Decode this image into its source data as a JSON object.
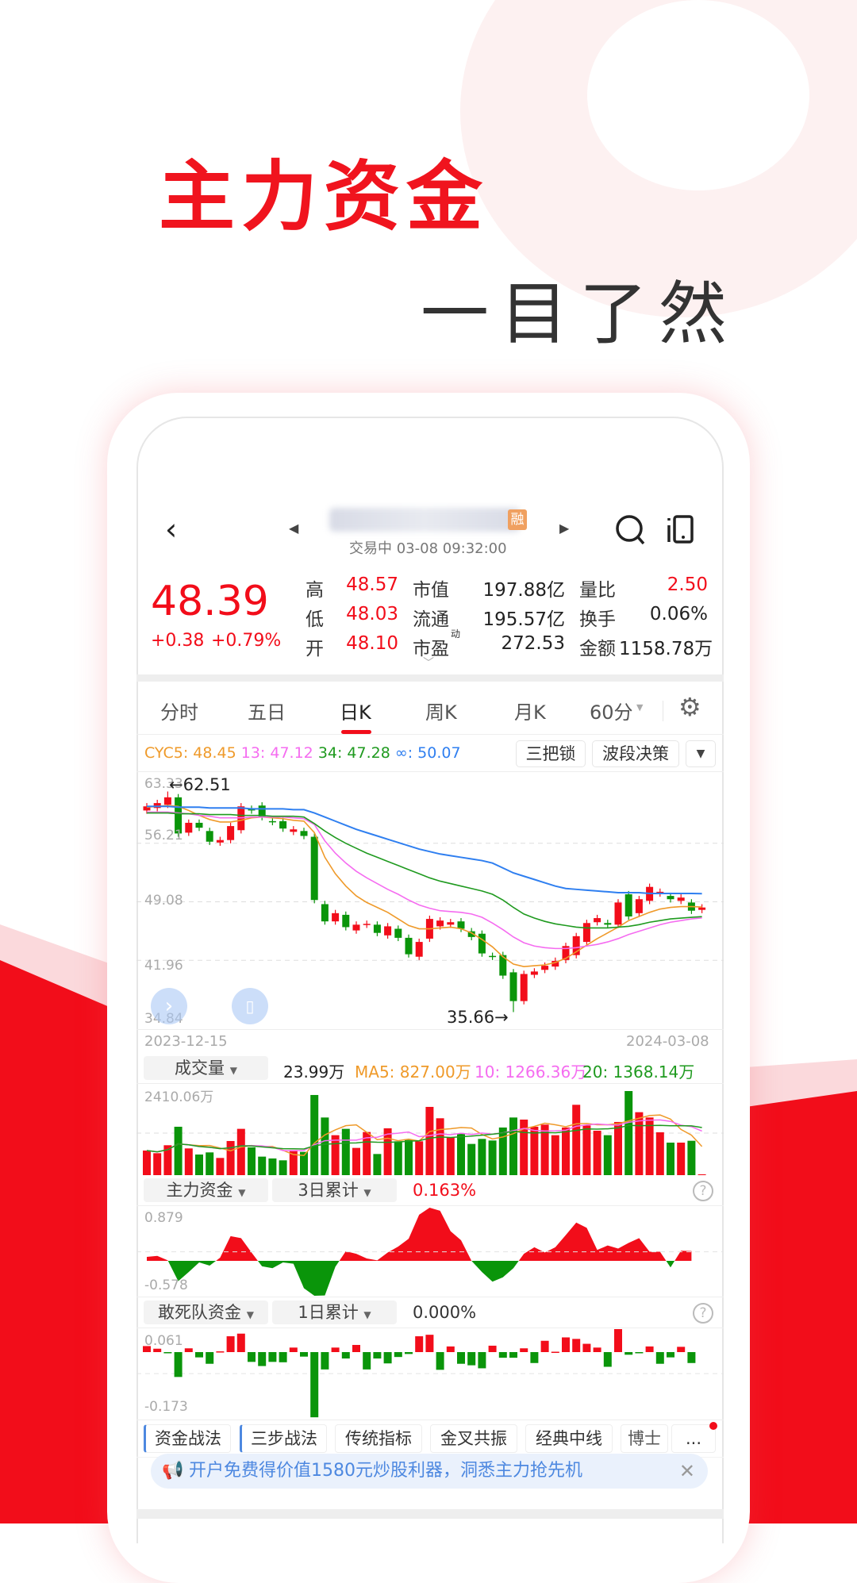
{
  "hero": {
    "title": "主力资金",
    "subtitle": "一目了然"
  },
  "colors": {
    "up": "#f20d1a",
    "down": "#0a950a",
    "cyc5": "#ef9a2a",
    "cyc13": "#f56cf0",
    "cyc34": "#1f9a1f",
    "cycinf": "#2f7ff0",
    "accent": "#f0141e",
    "promo": "#4d88e0"
  },
  "header": {
    "badge": "融",
    "status": "交易中 03-08 09:32:00",
    "icons": [
      "back-icon",
      "prev-stock-icon",
      "next-stock-icon",
      "search-icon",
      "portrait-toggle-icon"
    ]
  },
  "quote": {
    "price": "48.39",
    "change": "+0.38",
    "change_pct": "+0.79%",
    "stats": [
      {
        "label": "高",
        "value": "48.57",
        "label2": "市值",
        "value2": "197.88亿",
        "label3": "量比",
        "value3": "2.50"
      },
      {
        "label": "低",
        "value": "48.03",
        "label2": "流通",
        "value2": "195.57亿",
        "label3": "换手",
        "value3": "0.06%"
      },
      {
        "label": "开",
        "value": "48.10",
        "label2": "市盈",
        "sup": "动",
        "value2": "272.53",
        "label3": "金额",
        "value3": "1158.78万"
      }
    ]
  },
  "tabs": [
    {
      "label": "分时"
    },
    {
      "label": "五日"
    },
    {
      "label": "日K",
      "active": true
    },
    {
      "label": "周K"
    },
    {
      "label": "月K"
    },
    {
      "label": "60分"
    }
  ],
  "indicator_bar": {
    "cyc5": "CYC5: 48.45",
    "cyc13": "13: 47.12",
    "cyc34": "34: 47.28",
    "cycinf": "∞: 50.07",
    "buttons": [
      "三把锁",
      "波段决策"
    ]
  },
  "volume_bar": {
    "selector": "成交量",
    "current": "23.99万",
    "ma5": "MA5: 827.00万",
    "ma10": "10: 1266.36万",
    "ma20": "20: 1368.14万"
  },
  "fund_bar": {
    "selector": "主力资金",
    "period": "3日累计",
    "value": "0.163%"
  },
  "dead_bar": {
    "selector": "敢死队资金",
    "period": "1日累计",
    "value": "0.000%"
  },
  "strategy_tabs": [
    "资金战法",
    "三步战法",
    "传统指标",
    "金叉共振",
    "经典中线",
    "博士",
    "..."
  ],
  "promo": {
    "text": "开户免费得价值1580元炒股利器，洞悉主力抢先机"
  },
  "chart_data": [
    {
      "type": "candlestick",
      "x_start": "2023-12-15",
      "x_end": "2024-03-08",
      "y_ticks": [
        "63.33",
        "56.21",
        "49.08",
        "41.96",
        "34.84"
      ],
      "ylim": [
        34.84,
        63.33
      ],
      "grid": true,
      "high_label": "←62.51",
      "high": 62.51,
      "high_index": 2,
      "low_label": "35.66→",
      "low": 35.66,
      "low_index": 35,
      "candles": [
        [
          60.2,
          60.7
        ],
        [
          60.5,
          61.1
        ],
        [
          60.9,
          61.8
        ],
        [
          61.8,
          57.4
        ],
        [
          57.5,
          58.7
        ],
        [
          58.7,
          58.1
        ],
        [
          57.7,
          56.4
        ],
        [
          56.3,
          56.6
        ],
        [
          56.6,
          58.3
        ],
        [
          57.8,
          60.7
        ],
        [
          60.4,
          60.2
        ],
        [
          60.8,
          59.4
        ],
        [
          58.9,
          58.8
        ],
        [
          58.9,
          58.0
        ],
        [
          57.6,
          57.9
        ],
        [
          57.7,
          57.1
        ],
        [
          57.0,
          49.3
        ],
        [
          48.8,
          46.7
        ],
        [
          46.7,
          47.7
        ],
        [
          47.5,
          46.0
        ],
        [
          45.6,
          46.3
        ],
        [
          46.3,
          46.4
        ],
        [
          46.3,
          45.3
        ],
        [
          45.0,
          46.1
        ],
        [
          45.8,
          44.7
        ],
        [
          44.7,
          42.7
        ],
        [
          42.4,
          44.2
        ],
        [
          44.6,
          47.0
        ],
        [
          46.1,
          46.8
        ],
        [
          46.3,
          46.6
        ],
        [
          46.7,
          45.8
        ],
        [
          45.5,
          44.8
        ],
        [
          45.2,
          42.8
        ],
        [
          42.5,
          42.4
        ],
        [
          42.6,
          40.1
        ],
        [
          40.5,
          37.0
        ],
        [
          37.0,
          40.3
        ],
        [
          40.2,
          40.6
        ],
        [
          40.8,
          41.3
        ],
        [
          41.2,
          41.9
        ],
        [
          42.0,
          43.7
        ],
        [
          42.6,
          44.9
        ],
        [
          44.2,
          46.5
        ],
        [
          46.6,
          47.1
        ],
        [
          46.5,
          46.3
        ],
        [
          46.3,
          49.0
        ],
        [
          50.0,
          47.3
        ],
        [
          47.7,
          49.4
        ],
        [
          49.2,
          50.9
        ],
        [
          50.1,
          50.3
        ],
        [
          49.8,
          49.4
        ],
        [
          49.2,
          49.6
        ],
        [
          49.0,
          48.0
        ],
        [
          48.1,
          48.39
        ]
      ],
      "series": [
        {
          "name": "CYC5",
          "values": [
            60.6,
            60.7,
            60.8,
            60.7,
            60.2,
            59.6,
            59.1,
            58.8,
            58.8,
            59.0,
            59.3,
            59.4,
            59.3,
            59.2,
            59.0,
            58.9,
            57.5,
            54.5,
            52.5,
            51.0,
            49.8,
            49.0,
            48.4,
            47.8,
            47.0,
            46.2,
            45.8,
            45.8,
            45.9,
            46.0,
            45.8,
            45.3,
            44.5,
            43.6,
            42.4,
            41.5,
            41.2,
            41.3,
            41.4,
            41.7,
            42.2,
            43.0,
            43.8,
            44.6,
            45.3,
            46.0,
            46.8,
            47.3,
            47.8,
            48.2,
            48.4,
            48.5,
            48.5,
            48.45
          ]
        },
        {
          "name": "13",
          "values": [
            60.0,
            60.0,
            60.0,
            59.9,
            59.8,
            59.6,
            59.5,
            59.3,
            59.3,
            59.3,
            59.4,
            59.4,
            59.4,
            59.4,
            59.3,
            59.2,
            58.5,
            56.5,
            55.0,
            53.8,
            52.8,
            52.0,
            51.3,
            50.6,
            50.0,
            49.3,
            48.7,
            48.3,
            48.0,
            47.9,
            47.8,
            47.6,
            47.2,
            46.5,
            45.7,
            44.8,
            44.1,
            43.7,
            43.5,
            43.4,
            43.4,
            43.5,
            43.7,
            43.9,
            44.2,
            44.6,
            45.1,
            45.5,
            45.9,
            46.3,
            46.6,
            46.8,
            47.0,
            47.12
          ]
        },
        {
          "name": "34",
          "values": [
            59.9,
            59.9,
            59.9,
            59.8,
            59.8,
            59.8,
            59.7,
            59.7,
            59.7,
            59.6,
            59.6,
            59.6,
            59.5,
            59.5,
            59.5,
            59.4,
            58.6,
            57.7,
            56.9,
            56.2,
            55.6,
            55.0,
            54.5,
            54.0,
            53.5,
            53.0,
            52.5,
            52.0,
            51.6,
            51.3,
            51.0,
            50.7,
            50.4,
            50.0,
            49.3,
            48.4,
            47.6,
            47.1,
            46.7,
            46.4,
            46.2,
            46.0,
            45.9,
            45.9,
            45.9,
            46.0,
            46.1,
            46.3,
            46.6,
            46.8,
            47.0,
            47.1,
            47.2,
            47.28
          ]
        },
        {
          "name": "∞",
          "values": [
            60.7,
            60.7,
            60.7,
            60.6,
            60.6,
            60.6,
            60.5,
            60.5,
            60.5,
            60.5,
            60.4,
            60.4,
            60.4,
            60.4,
            60.3,
            60.3,
            59.9,
            59.4,
            58.9,
            58.4,
            57.9,
            57.5,
            57.1,
            56.7,
            56.3,
            55.9,
            55.5,
            55.2,
            54.9,
            54.7,
            54.5,
            54.3,
            54.1,
            53.8,
            53.2,
            52.6,
            52.2,
            51.8,
            51.4,
            51.0,
            50.7,
            50.6,
            50.5,
            50.4,
            50.3,
            50.2,
            50.2,
            50.2,
            50.1,
            50.1,
            50.1,
            50.1,
            50.1,
            50.07
          ]
        }
      ]
    },
    {
      "type": "bar",
      "name": "成交量",
      "unit": "万",
      "y_max_label": "2410.06万",
      "ylim": [
        0,
        2410.06
      ],
      "values": [
        705,
        629,
        857,
        1387,
        766,
        591,
        652,
        493,
        978,
        1327,
        796,
        531,
        478,
        425,
        720,
        667,
        2297,
        1652,
        1145,
        1327,
        781,
        1236,
        606,
        1342,
        970,
        1008,
        970,
        1956,
        1630,
        1084,
        1183,
        895,
        1039,
        993,
        1365,
        1652,
        1592,
        1387,
        1448,
        1145,
        1365,
        2016,
        1425,
        1273,
        1145,
        1524,
        2410.06,
        1804,
        1652,
        1228,
        932,
        932,
        985,
        23.99
      ]
    },
    {
      "type": "area",
      "name": "主力资金",
      "y_ticks": [
        "0.879",
        "-0.578"
      ],
      "ylim": [
        -0.578,
        0.879
      ],
      "values": [
        0.065,
        0.082,
        0.009,
        -0.336,
        -0.185,
        -0.026,
        -0.078,
        0.052,
        0.409,
        0.375,
        0.138,
        -0.091,
        -0.121,
        -0.026,
        -0.047,
        -0.453,
        -0.578,
        -0.573,
        -0.099,
        0.159,
        0.116,
        0.039,
        0.009,
        0.138,
        0.237,
        0.366,
        0.763,
        0.879,
        0.828,
        0.491,
        0.341,
        0,
        -0.185,
        -0.345,
        -0.272,
        -0.121,
        0.116,
        0.224,
        0.138,
        0.224,
        0.427,
        0.634,
        0.547,
        0.181,
        0.254,
        0.203,
        0.297,
        0.375,
        0.151,
        0.151,
        -0.108,
        0.168,
        0.163
      ]
    },
    {
      "type": "bar",
      "name": "敢死队资金",
      "y_ticks": [
        "0.061",
        "-0.173"
      ],
      "ylim": [
        -0.173,
        0.061
      ],
      "values": [
        0.016,
        0.009,
        -0.003,
        -0.066,
        0.01,
        -0.014,
        -0.031,
        0.002,
        0.042,
        0.049,
        -0.026,
        -0.037,
        -0.026,
        -0.027,
        0.012,
        -0.012,
        -0.173,
        -0.046,
        0.012,
        -0.017,
        0.019,
        -0.046,
        -0.017,
        -0.03,
        -0.013,
        -0.005,
        0.042,
        0.046,
        -0.047,
        0.015,
        -0.031,
        -0.035,
        -0.043,
        0.017,
        -0.015,
        -0.015,
        0.01,
        -0.029,
        0.03,
        0.001,
        0.039,
        0.035,
        0.022,
        0.012,
        -0.039,
        0.061,
        -0.007,
        -0.002,
        0.015,
        -0.031,
        -0.014,
        0.014,
        -0.029
      ]
    }
  ]
}
